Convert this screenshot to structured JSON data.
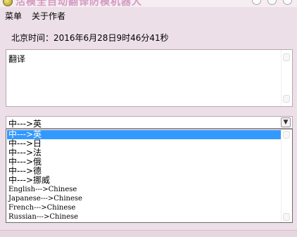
{
  "window": {
    "title": "活模全自动翻译防模机器人"
  },
  "menu": {
    "items": [
      "菜单",
      "关于作者"
    ]
  },
  "clock": {
    "label": "北京时间：2016年6月28日9时46分41秒"
  },
  "input": {
    "value": "翻译"
  },
  "direction": {
    "selected": "中--->英",
    "options": [
      "中--->英",
      "中--->日",
      "中--->法",
      "中--->俄",
      "中--->德",
      "中--->挪威",
      "English--->Chinese",
      "Japanese--->Chinese",
      "French--->Chinese",
      "Russian--->Chinese"
    ]
  },
  "colors": {
    "selection": "#3399ff",
    "window_bg": "#ecdfe7"
  }
}
